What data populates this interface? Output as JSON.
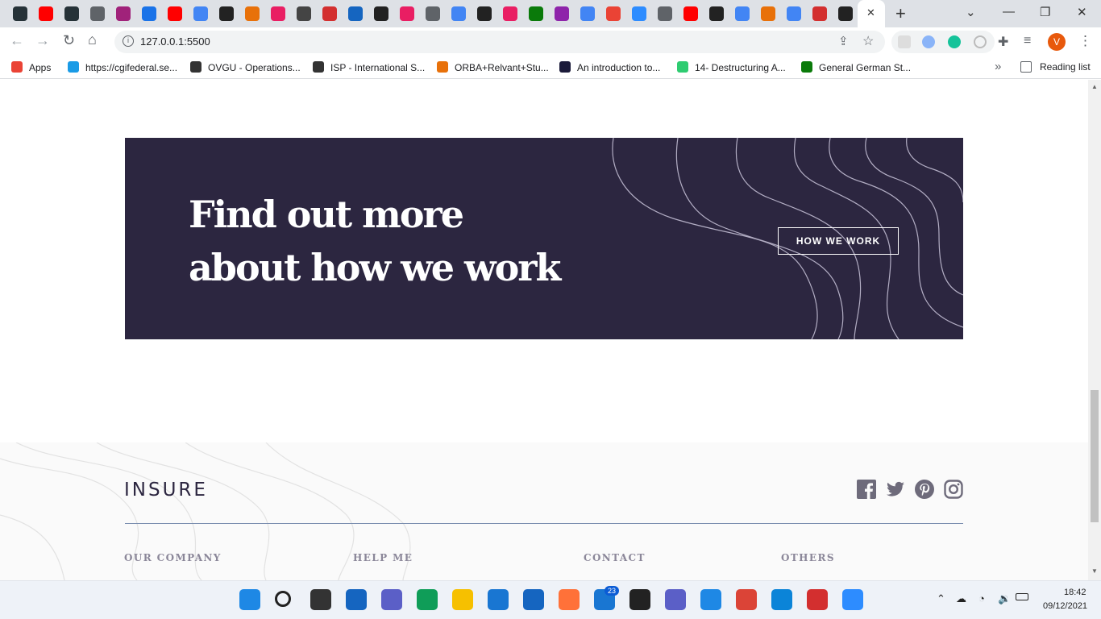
{
  "browser": {
    "tab_count_icons": 34,
    "url": "127.0.0.1:5500",
    "close_glyph": "✕",
    "new_tab_glyph": "+",
    "bookmarks": [
      {
        "label": "Apps",
        "color": "#ea4335"
      },
      {
        "label": "https://cgifederal.se...",
        "color": "#1a9be6"
      },
      {
        "label": "OVGU - Operations...",
        "color": "#333333"
      },
      {
        "label": "ISP - International S...",
        "color": "#333333"
      },
      {
        "label": "ORBA+Relvant+Stu...",
        "color": "#e8710a"
      },
      {
        "label": "An introduction to...",
        "color": "#1b1b3a"
      },
      {
        "label": "14- Destructuring A...",
        "color": "#2ecc71"
      },
      {
        "label": "General German St...",
        "color": "#0a7a0a"
      }
    ],
    "more_bookmarks": "»",
    "reading_list": "Reading list",
    "profile_initial": "V"
  },
  "banner": {
    "heading_line1": "Find out more",
    "heading_line2": "about how we work",
    "cta_label": "HOW WE WORK"
  },
  "footer": {
    "logo": "INSURE",
    "columns": [
      "OUR COMPANY",
      "HELP ME",
      "CONTACT",
      "OTHERS"
    ],
    "social_icons": [
      "facebook-icon",
      "twitter-icon",
      "pinterest-icon",
      "instagram-icon"
    ]
  },
  "taskbar": {
    "badge_count": "23",
    "time": "18:42",
    "date": "09/12/2021"
  },
  "colors": {
    "banner_bg": "#2c2640",
    "footer_bg": "#fafafa",
    "accent_divider": "#7a8eaf",
    "heading_text": "#ffffff"
  }
}
